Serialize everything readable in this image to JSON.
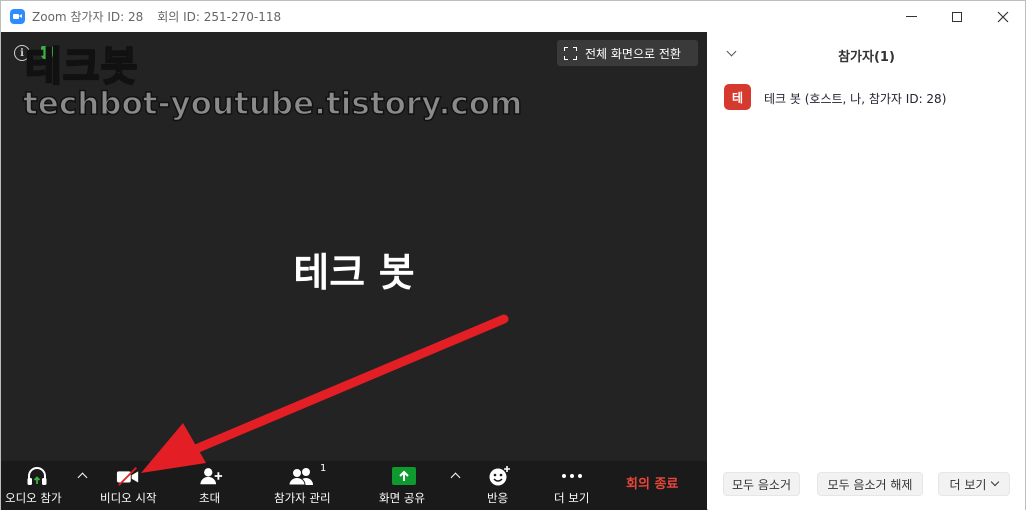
{
  "window": {
    "title": "Zoom 참가자 ID: 28",
    "meeting_id": "회의 ID: 251-270-118"
  },
  "video": {
    "watermark_title": "테크봇",
    "watermark_url": "techbot-youtube.tistory.com",
    "fullscreen_label": "전체 화면으로 전환",
    "participant_name": "테크 봇",
    "info_icon_glyph": "i"
  },
  "toolbar": {
    "audio_label": "오디오 참가",
    "video_label": "비디오 시작",
    "invite_label": "초대",
    "participants_label": "참가자 관리",
    "participants_count": "1",
    "share_label": "화면 공유",
    "reactions_label": "반응",
    "more_label": "더 보기",
    "end_label": "회의 종료"
  },
  "panel": {
    "title": "참가자(1)",
    "participants": [
      {
        "avatar_initial": "테",
        "name": "테크 봇 (호스트, 나, 참가자 ID: 28)"
      }
    ],
    "mute_all_label": "모두 음소거",
    "unmute_all_label": "모두 음소거 해제",
    "more_label": "더 보기"
  },
  "colors": {
    "share_green": "#0e9a2e",
    "end_red": "#e8463a",
    "avatar_red": "#d63a2f",
    "annotation_arrow": "#e31e24"
  }
}
